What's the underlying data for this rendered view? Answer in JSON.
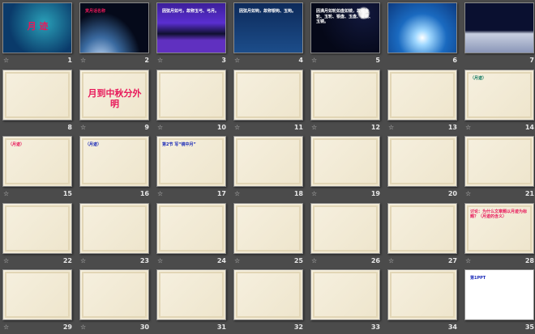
{
  "view": "slide-sorter",
  "slides": [
    {
      "n": "1",
      "anim": true,
      "theme": "dark1",
      "color": "c-pink",
      "big": true,
      "text": "月 迹"
    },
    {
      "n": "2",
      "anim": true,
      "theme": "dark2",
      "color": "c-pink",
      "text": "赏月话名称"
    },
    {
      "n": "3",
      "anim": true,
      "theme": "dark3",
      "color": "c-white",
      "text": "因弦月如弓，故称玉弓、弓月。"
    },
    {
      "n": "4",
      "anim": true,
      "theme": "dark4",
      "color": "c-white",
      "text": "因弦月如钩，故称银钩、玉钩。"
    },
    {
      "n": "5",
      "anim": true,
      "theme": "dark5",
      "color": "c-white",
      "text": "因满月如轮如盘如镜，故称金轮、玉轮、银盘、玉盘、金镜、玉镜。"
    },
    {
      "n": "6",
      "anim": false,
      "theme": "dark6",
      "color": "c-red",
      "text": ""
    },
    {
      "n": "7",
      "anim": false,
      "theme": "dark7",
      "color": "c-red",
      "text": ""
    },
    {
      "n": "8",
      "anim": false,
      "theme": "paper",
      "color": "c-green",
      "text": ""
    },
    {
      "n": "9",
      "anim": true,
      "theme": "paper",
      "color": "c-pink",
      "big": true,
      "text": "月到中秋分外明"
    },
    {
      "n": "10",
      "anim": true,
      "theme": "paper",
      "color": "c-teal",
      "text": ""
    },
    {
      "n": "11",
      "anim": true,
      "theme": "paper",
      "color": "c-pink",
      "text": ""
    },
    {
      "n": "12",
      "anim": true,
      "theme": "paper",
      "color": "c-red",
      "text": ""
    },
    {
      "n": "13",
      "anim": true,
      "theme": "paper",
      "color": "c-red",
      "text": ""
    },
    {
      "n": "14",
      "anim": true,
      "theme": "paper",
      "color": "c-green",
      "text": "（月迹）"
    },
    {
      "n": "15",
      "anim": true,
      "theme": "paper",
      "color": "c-pink",
      "text": "（月迹）"
    },
    {
      "n": "16",
      "anim": false,
      "theme": "paper",
      "color": "c-blue",
      "text": "（月迹）"
    },
    {
      "n": "17",
      "anim": true,
      "theme": "paper",
      "color": "c-blue",
      "text": "第2节 写“镜中月”"
    },
    {
      "n": "18",
      "anim": true,
      "theme": "paper",
      "color": "c-green",
      "text": ""
    },
    {
      "n": "19",
      "anim": true,
      "theme": "paper",
      "color": "c-blue",
      "text": ""
    },
    {
      "n": "20",
      "anim": false,
      "theme": "paper",
      "color": "c-green",
      "text": ""
    },
    {
      "n": "21",
      "anim": true,
      "theme": "paper",
      "color": "c-green",
      "text": ""
    },
    {
      "n": "22",
      "anim": true,
      "theme": "paper",
      "color": "c-green",
      "text": ""
    },
    {
      "n": "23",
      "anim": true,
      "theme": "paper",
      "color": "c-green",
      "text": ""
    },
    {
      "n": "24",
      "anim": true,
      "theme": "paper",
      "color": "c-green",
      "text": ""
    },
    {
      "n": "25",
      "anim": true,
      "theme": "paper",
      "color": "c-green",
      "text": ""
    },
    {
      "n": "26",
      "anim": true,
      "theme": "paper",
      "color": "c-blue",
      "text": ""
    },
    {
      "n": "27",
      "anim": true,
      "theme": "paper",
      "color": "c-blue",
      "text": ""
    },
    {
      "n": "28",
      "anim": true,
      "theme": "paper",
      "color": "c-pink",
      "text": "讨论：为什么文章题以月迹为标题？（月迹的含义）"
    },
    {
      "n": "29",
      "anim": true,
      "theme": "paper",
      "color": "c-orange",
      "text": ""
    },
    {
      "n": "30",
      "anim": true,
      "theme": "paper",
      "color": "c-green",
      "text": ""
    },
    {
      "n": "31",
      "anim": false,
      "theme": "paper",
      "color": "c-blue",
      "text": ""
    },
    {
      "n": "32",
      "anim": false,
      "theme": "paper",
      "color": "c-green",
      "text": ""
    },
    {
      "n": "33",
      "anim": false,
      "theme": "paper",
      "color": "c-blue",
      "text": ""
    },
    {
      "n": "34",
      "anim": false,
      "theme": "paper",
      "color": "c-pink",
      "text": ""
    },
    {
      "n": "35",
      "anim": false,
      "theme": "white",
      "color": "c-blue",
      "text": "第1PPT"
    }
  ],
  "anim_icon": "☆"
}
